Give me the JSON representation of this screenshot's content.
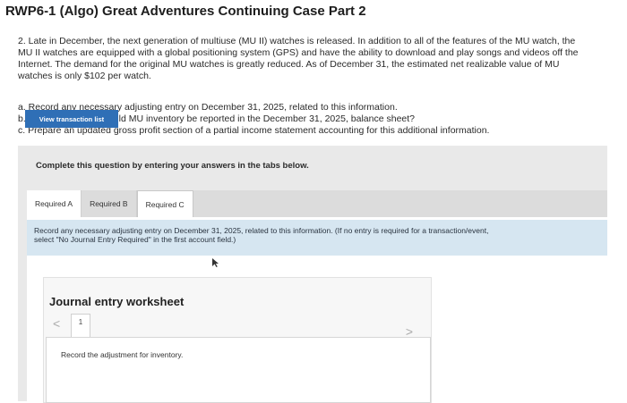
{
  "title": "RWP6-1 (Algo) Great Adventures Continuing Case Part 2",
  "problem": {
    "line1": "2. Late in December, the next generation of multiuse (MU II) watches is released. In addition to all of the features of the MU watch, the",
    "line2": "MU II watches are equipped with a global positioning system (GPS) and have the ability to download and play songs and videos off the",
    "line3": "Internet. The demand for the original MU watches is greatly reduced. As of December 31, the estimated net realizable value of MU",
    "line4": "watches is only $102 per watch."
  },
  "parts": {
    "a": "a. Record any necessary adjusting entry on December 31, 2025, related to this information.",
    "b": "b. For what amount would MU inventory be reported in the December 31, 2025, balance sheet?",
    "c": "c. Prepare an updated gross profit section of a partial income statement accounting for this additional information."
  },
  "instruction": "Complete this question by entering your answers in the tabs below.",
  "tabs": [
    "Required A",
    "Required B",
    "Required C"
  ],
  "info": {
    "line1": "Record any necessary adjusting entry on December 31, 2025, related to this information. (If no entry is required for a transaction/event,",
    "line2": "select \"No Journal Entry Required\" in the first account field.)"
  },
  "view_button": "View transaction list",
  "worksheet": {
    "title": "Journal entry worksheet",
    "prev": "<",
    "page": "1",
    "next": ">",
    "text": "Record the adjustment for inventory."
  }
}
